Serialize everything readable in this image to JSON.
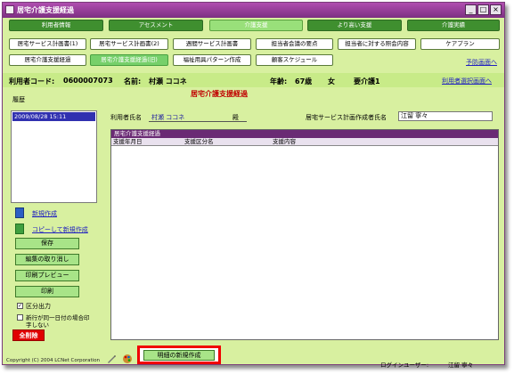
{
  "window": {
    "title": "居宅介護支援経過",
    "buttons": {
      "minimize": "_",
      "maximize": "□",
      "close": "×"
    }
  },
  "menu_row1": [
    "利用者情報",
    "アセスメント",
    "介護支援",
    "より高い支援",
    "介護実績"
  ],
  "menu_row2": [
    "居宅サービス計画書(1)",
    "居宅サービス計画書(2)",
    "週間サービス計画書",
    "担当者会議の要点",
    "担当者に対する照会内容",
    "ケアプラン"
  ],
  "menu_row3": [
    "居宅介護支援経過",
    "居宅介護支援経過(旧)",
    "福祉用具パターン作成",
    "顧客スケジュール"
  ],
  "links": {
    "yobou": "予防画面へ",
    "select_user": "利用者選択画面へ"
  },
  "info": {
    "code_label": "利用者コード:",
    "code": "0600007073",
    "name_label": "名前:",
    "name": "村瀬 ココネ",
    "age_label": "年齢:",
    "age": "67歳",
    "sex": "女",
    "care_level": "要介護1"
  },
  "section_title": "居宅介護支援経過",
  "history": {
    "label": "履歴",
    "items": [
      "2009/08/28 15:11"
    ]
  },
  "actions": {
    "new": "新規作成",
    "copy_new": "コピーして新規作成"
  },
  "side_buttons": [
    "保存",
    "編集の取り消し",
    "印刷プレビュー",
    "印刷"
  ],
  "checkboxes": {
    "section_output": {
      "label": "区分出力",
      "checked": true
    },
    "same_day": {
      "label_line1": "新行が同一日付の場合印",
      "label_line2": "字しない",
      "checked": false
    }
  },
  "delete_button": "全削除",
  "form": {
    "user_name_label": "利用者氏名",
    "user_name": "村瀬  ココネ",
    "honorific": "殿",
    "planner_label": "居宅サービス計画作成者氏名",
    "planner_value": "江留  寧々"
  },
  "grid": {
    "title": "居宅介護支援経過",
    "columns": [
      "支援年月日",
      "支援区分名",
      "支援内容"
    ]
  },
  "footer": {
    "copyright": "Copyright (C) 2004 LCNet Corporation",
    "new_detail_button": "明細の新規作成",
    "login_label": "ログインユーザー:",
    "login_user": "江留  寧々"
  },
  "colors": {
    "titlebar": "#7c2f82",
    "background": "#d8f0a0",
    "menu_green": "#3f8f2f",
    "highlight_red": "#f00000",
    "delete_red": "#e00000"
  }
}
